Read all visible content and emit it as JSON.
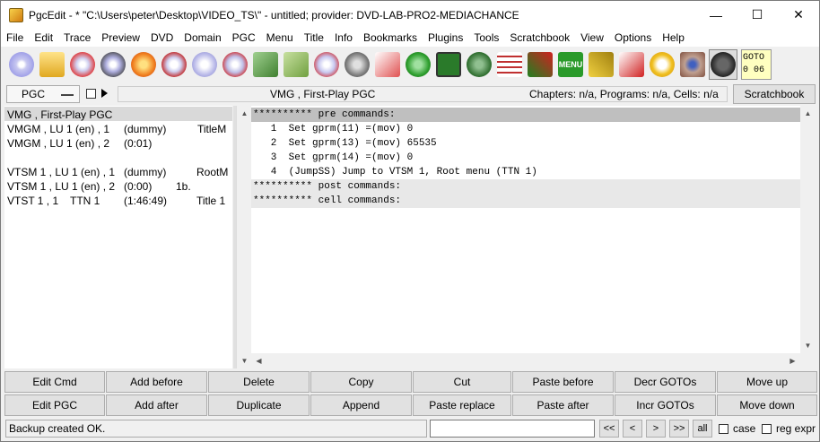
{
  "window": {
    "title": "PgcEdit - * \"C:\\Users\\peter\\Desktop\\VIDEO_TS\\\" - untitled; provider: DVD-LAB-PRO2-MEDIACHANCE",
    "minimize": "—",
    "maximize": "☐",
    "close": "✕"
  },
  "menu": [
    "File",
    "Edit",
    "Trace",
    "Preview",
    "DVD",
    "Domain",
    "PGC",
    "Menu",
    "Title",
    "Info",
    "Bookmarks",
    "Plugins",
    "Tools",
    "Scratchbook",
    "View",
    "Options",
    "Help"
  ],
  "toolbar": {
    "icons": [
      "disc-icon",
      "open-folder-icon",
      "reload-disc-icon",
      "new-disc-icon",
      "burn-icon",
      "search-disc-icon",
      "multi-disc-icon",
      "disc-bookmark-icon",
      "save-green-icon",
      "save-as-icon",
      "checkmark-disc-icon",
      "ifo-icon",
      "copy-doc-icon",
      "globe-icon",
      "preview-play-icon",
      "film-reel-icon",
      "checklist-icon",
      "menu-cross-icon",
      "menu-green-icon",
      "chain-link-icon",
      "numbers-search-icon",
      "tel-icon",
      "eye-icon",
      "navigation-icon"
    ],
    "menu_label": "MENU",
    "goto_line1": "GOTO",
    "goto_line2": "0 06"
  },
  "infobar": {
    "pgc_combo": "PGC",
    "pgc_title": "VMG , First-Play PGC",
    "stats": "Chapters: n/a,  Programs: n/a,  Cells: n/a",
    "scratchbook_button": "Scratchbook"
  },
  "pgc_list": [
    {
      "name": "VMG , First-Play PGC",
      "c2": "",
      "c3": "",
      "c4": "",
      "c5": ""
    },
    {
      "name": "VMGM , LU 1 (en) , 1",
      "c2": "",
      "c3": "(dummy)",
      "c4": "",
      "c5": "TitleM"
    },
    {
      "name": "VMGM , LU 1 (en) , 2",
      "c2": "",
      "c3": "(0:01)",
      "c4": "",
      "c5": ""
    },
    {
      "name": "VTSM 1 , LU 1 (en) , 1",
      "c2": "",
      "c3": "(dummy)",
      "c4": "",
      "c5": "RootM"
    },
    {
      "name": "VTSM 1 , LU 1 (en) , 2",
      "c2": "",
      "c3": "(0:00)",
      "c4": "1b.",
      "c5": ""
    },
    {
      "name": "VTST 1 , 1",
      "c2": "TTN 1",
      "c3": "(1:46:49)",
      "c4": "",
      "c5": "Title 1"
    }
  ],
  "code_lines": [
    "********** pre commands:",
    "   1  Set gprm(11) =(mov) 0",
    "   2  Set gprm(13) =(mov) 65535",
    "   3  Set gprm(14) =(mov) 0",
    "   4  (JumpSS) Jump to VTSM 1, Root menu (TTN 1)",
    "********** post commands:",
    "********** cell commands:"
  ],
  "buttons_row1": [
    "Edit Cmd",
    "Add before",
    "Delete",
    "Copy",
    "Cut",
    "Paste before",
    "Decr GOTOs",
    "Move up"
  ],
  "buttons_row2": [
    "Edit PGC",
    "Add after",
    "Duplicate",
    "Append",
    "Paste replace",
    "Paste after",
    "Incr GOTOs",
    "Move down"
  ],
  "status": {
    "text": "Backup created OK.",
    "search_value": "",
    "nav": [
      "<<",
      "<",
      ">",
      ">>"
    ],
    "all": "all",
    "case": "case",
    "regexpr": "reg expr"
  },
  "colors": {
    "selection": "#bfbfbf",
    "header_line": "#e8e8e8",
    "goto_bg": "#ffffc0"
  }
}
